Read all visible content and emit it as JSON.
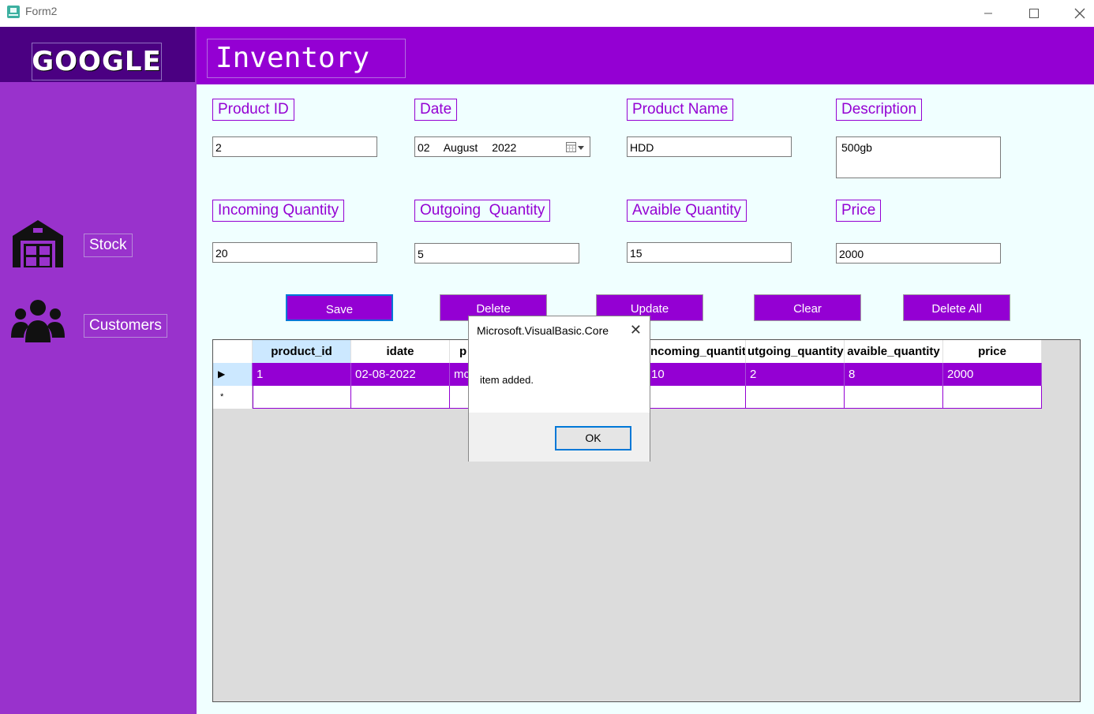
{
  "window": {
    "title": "Form2",
    "minimize": "—",
    "maximize": "☐",
    "close": "✕"
  },
  "sidebar": {
    "logo": "GOOGLE",
    "items": [
      {
        "label": "Stock",
        "icon": "warehouse-icon"
      },
      {
        "label": "Customers",
        "icon": "users-icon"
      }
    ]
  },
  "header": {
    "title": "Inventory"
  },
  "form": {
    "product_id_label": "Product ID",
    "product_id_value": "2",
    "date_label": "Date",
    "date_day": "02",
    "date_month": "August",
    "date_year": "2022",
    "product_name_label": "Product Name",
    "product_name_value": "HDD",
    "description_label": "Description",
    "description_value": "500gb",
    "incoming_label": "Incoming Quantity",
    "incoming_value": "20",
    "outgoing_label": "Outgoing  Quantity",
    "outgoing_value": "5",
    "available_label": "Avaible Quantity",
    "available_value": "15",
    "price_label": "Price",
    "price_value": "2000"
  },
  "buttons": {
    "save": "Save",
    "delete": "Delete",
    "update": "Update",
    "clear": "Clear",
    "delete_all": "Delete All"
  },
  "grid": {
    "columns": [
      "product_id",
      "idate",
      "p",
      "ncoming_quantity",
      "utgoing_quantity",
      "avaible_quantity",
      "price"
    ],
    "rows": [
      [
        "1",
        "02-08-2022",
        "mc",
        "10",
        "2",
        "8",
        "2000"
      ]
    ],
    "new_row_marker": "*",
    "current_row_marker": "▶"
  },
  "dialog": {
    "title": "Microsoft.VisualBasic.Core",
    "message": "item added.",
    "ok": "OK",
    "close": "✕"
  },
  "colors": {
    "sidebar": "#9932cc",
    "logo_band": "#4b0082",
    "header": "#9400d3",
    "accent": "#9400d3",
    "main_bg": "#f0ffff"
  }
}
